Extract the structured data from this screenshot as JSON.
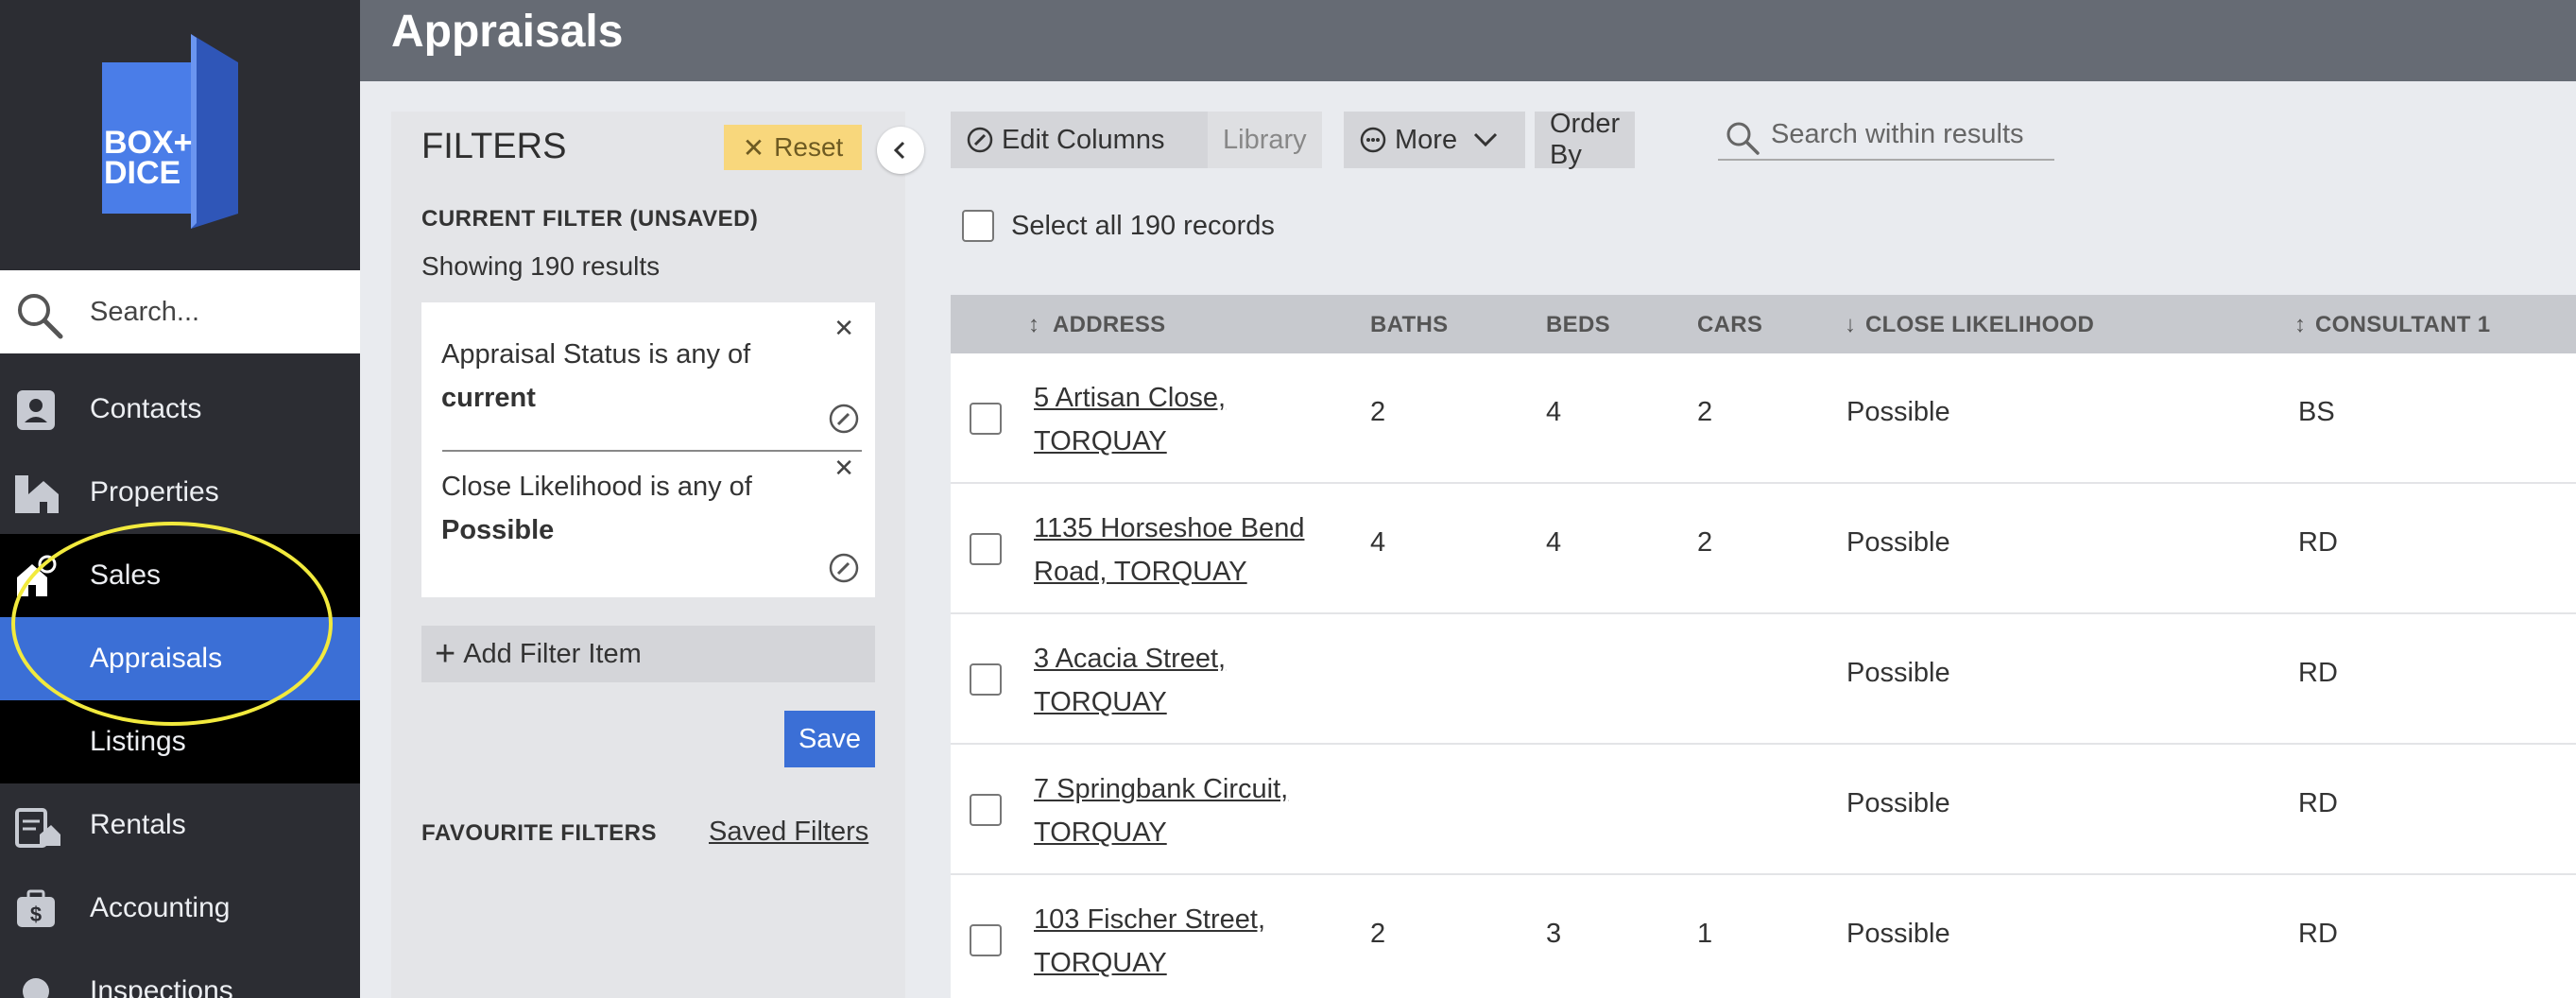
{
  "app": {
    "logo_text_line1": "BOX+",
    "logo_text_line2": "DICE"
  },
  "header": {
    "title": "Appraisals"
  },
  "sidebar": {
    "search_placeholder": "Search...",
    "items": [
      {
        "label": "Contacts",
        "icon": "contacts-icon"
      },
      {
        "label": "Properties",
        "icon": "properties-icon"
      },
      {
        "label": "Sales",
        "icon": "sales-icon"
      },
      {
        "label": "Appraisals",
        "icon": ""
      },
      {
        "label": "Listings",
        "icon": ""
      },
      {
        "label": "Rentals",
        "icon": "rentals-icon"
      },
      {
        "label": "Accounting",
        "icon": "accounting-icon"
      },
      {
        "label": "Inspections",
        "icon": "inspections-icon"
      }
    ]
  },
  "filters": {
    "title": "FILTERS",
    "reset_label": "Reset",
    "current_label": "CURRENT FILTER (UNSAVED)",
    "showing": "Showing 190 results",
    "items": [
      {
        "text": "Appraisal Status is any of",
        "value": "current"
      },
      {
        "text": "Close Likelihood is any of",
        "value": "Possible"
      }
    ],
    "add_label": "Add Filter Item",
    "save_label": "Save",
    "favourite_label": "FAVOURITE FILTERS",
    "saved_link": "Saved Filters"
  },
  "toolbar": {
    "edit_columns": "Edit Columns",
    "library": "Library",
    "more": "More",
    "order_by": "Order By",
    "search_placeholder": "Search within results",
    "select_all": "Select all 190 records"
  },
  "table": {
    "columns": [
      "ADDRESS",
      "BATHS",
      "BEDS",
      "CARS",
      "CLOSE LIKELIHOOD",
      "CONSULTANT 1"
    ],
    "rows": [
      {
        "addr1": "5 Artisan Close,",
        "addr2": "TORQUAY",
        "baths": "2",
        "beds": "4",
        "cars": "2",
        "likelihood": "Possible",
        "consultant": "BS"
      },
      {
        "addr1": "1135 Horseshoe Bend",
        "addr2": "Road, TORQUAY",
        "baths": "4",
        "beds": "4",
        "cars": "2",
        "likelihood": "Possible",
        "consultant": "RD"
      },
      {
        "addr1": "3 Acacia Street,",
        "addr2": "TORQUAY",
        "baths": "",
        "beds": "",
        "cars": "",
        "likelihood": "Possible",
        "consultant": "RD"
      },
      {
        "addr1": "7 Springbank Circuit,",
        "addr2": "TORQUAY",
        "baths": "",
        "beds": "",
        "cars": "",
        "likelihood": "Possible",
        "consultant": "RD"
      },
      {
        "addr1": "103 Fischer Street,",
        "addr2": "TORQUAY",
        "baths": "2",
        "beds": "3",
        "cars": "1",
        "likelihood": "Possible",
        "consultant": "RD"
      }
    ]
  },
  "colors": {
    "accent": "#3b6fd6",
    "sidebar": "#2c2d33",
    "header": "#666b74",
    "reset": "#f8d77c",
    "highlight": "#f2ea3d"
  }
}
